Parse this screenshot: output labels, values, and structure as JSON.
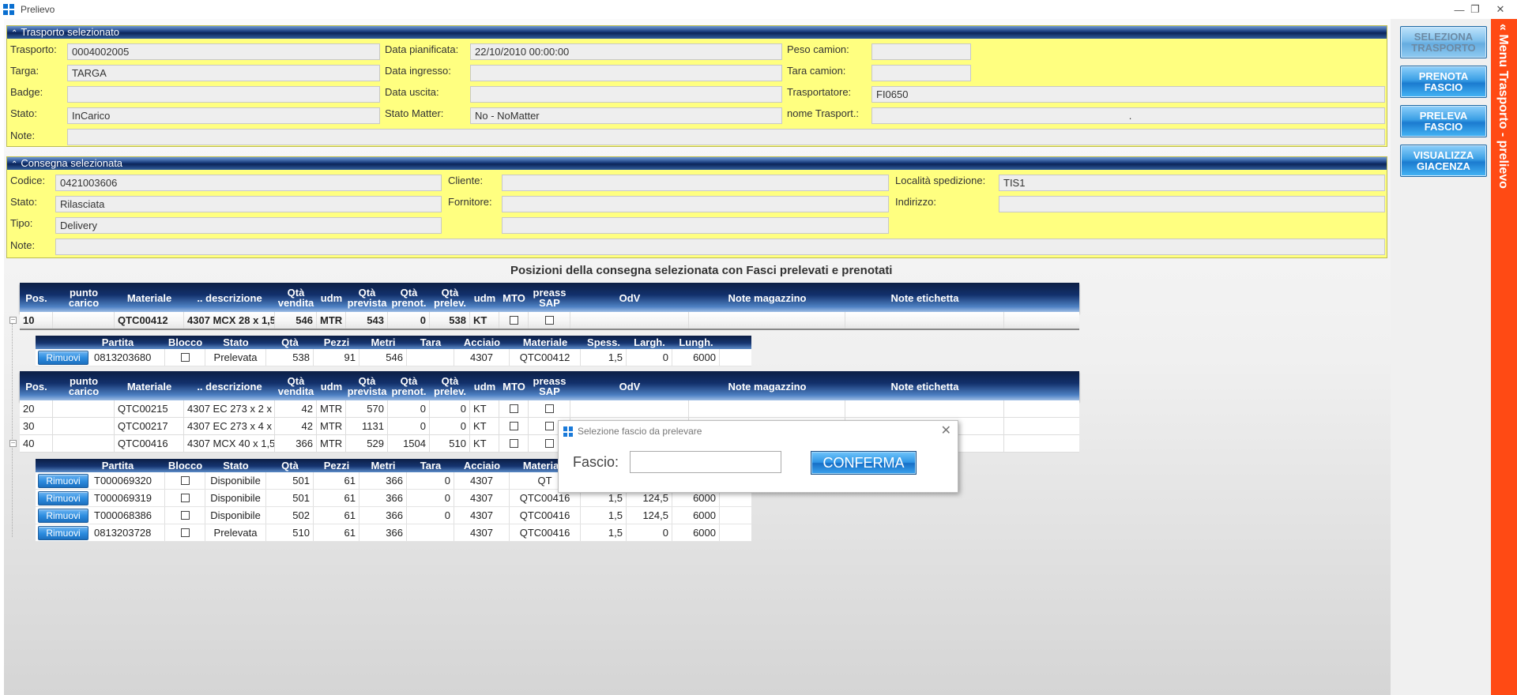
{
  "window": {
    "title": "Prelievo",
    "minimize": "—",
    "restore": "❐",
    "close": "✕"
  },
  "trasporto": {
    "header": "Trasporto selezionato",
    "labels": {
      "trasporto": "Trasporto:",
      "targa": "Targa:",
      "badge": "Badge:",
      "stato": "Stato:",
      "note": "Note:",
      "data_pianificata": "Data pianificata:",
      "data_ingresso": "Data ingresso:",
      "data_uscita": "Data uscita:",
      "stato_matter": "Stato Matter:",
      "peso_camion": "Peso camion:",
      "tara_camion": "Tara camion:",
      "trasportatore": "Trasportatore:",
      "nome_trasport": "nome Trasport.:"
    },
    "values": {
      "trasporto": "0004002005",
      "targa": "TARGA",
      "badge": "",
      "stato": "InCarico",
      "note": "",
      "data_pianificata": "22/10/2010 00:00:00",
      "data_ingresso": "",
      "data_uscita": "",
      "stato_matter": "No - NoMatter",
      "peso_camion": "",
      "tara_camion": "",
      "trasportatore": "FI0650",
      "nome_trasport": "."
    }
  },
  "consegna": {
    "header": "Consegna selezionata",
    "labels": {
      "codice": "Codice:",
      "stato": "Stato:",
      "tipo": "Tipo:",
      "note": "Note:",
      "cliente": "Cliente:",
      "fornitore": "Fornitore:",
      "localita": "Località spedizione:",
      "indirizzo": "Indirizzo:"
    },
    "values": {
      "codice": "0421003606",
      "stato": "Rilasciata",
      "tipo": "Delivery",
      "note": "",
      "cliente": "",
      "fornitore": "",
      "extra": "",
      "localita": "TIS1",
      "indirizzo": ""
    }
  },
  "positions_title": "Posizioni della consegna selezionata con Fasci prelevati e prenotati",
  "grid_headers": [
    "Pos.",
    "punto\ncarico",
    "Materiale",
    ".. descrizione",
    "Qtà\nvendita",
    "udm",
    "Qtà\nprevista",
    "Qtà\nprenot.",
    "Qtà\nprelev.",
    "udm",
    "MTO",
    "preass\nSAP",
    "OdV",
    "Note magazzino",
    "Note etichetta"
  ],
  "sub_headers": [
    "Partita",
    "Blocco",
    "Stato",
    "Qtà",
    "Pezzi",
    "Metri",
    "Tara",
    "Acciaio",
    "Materiale",
    "Spess.",
    "Largh.",
    "Lungh."
  ],
  "remove_label": "Rimuovi",
  "row10": {
    "pos": "10",
    "materiale": "QTC00412",
    "descr": "4307 MCX 28 x 1,5 x",
    "qvend": "546",
    "udm": "MTR",
    "qprev": "543",
    "qpren": "0",
    "qprel": "538",
    "udm2": "KT"
  },
  "sub10": [
    {
      "partita": "0813203680",
      "stato": "Prelevata",
      "qta": "538",
      "pezzi": "91",
      "metri": "546",
      "tara": "",
      "acciaio": "4307",
      "materiale": "QTC00412",
      "spess": "1,5",
      "largh": "0",
      "lungh": "6000"
    }
  ],
  "rows": [
    {
      "pos": "20",
      "materiale": "QTC00215",
      "descr": "4307 EC 273 x 2 x 6",
      "qvend": "42",
      "udm": "MTR",
      "qprev": "570",
      "qpren": "0",
      "qprel": "0",
      "udm2": "KT"
    },
    {
      "pos": "30",
      "materiale": "QTC00217",
      "descr": "4307 EC 273 x 4 x 6",
      "qvend": "42",
      "udm": "MTR",
      "qprev": "1131",
      "qpren": "0",
      "qprel": "0",
      "udm2": "KT"
    },
    {
      "pos": "40",
      "materiale": "QTC00416",
      "descr": "4307 MCX 40 x 1,5 x",
      "qvend": "366",
      "udm": "MTR",
      "qprev": "529",
      "qpren": "1504",
      "qprel": "510",
      "udm2": "KT"
    }
  ],
  "sub40": [
    {
      "partita": "T000069320",
      "stato": "Disponibile",
      "qta": "501",
      "pezzi": "61",
      "metri": "366",
      "tara": "0",
      "acciaio": "4307",
      "materiale": "QT",
      "spess": "",
      "largh": "",
      "lungh": ""
    },
    {
      "partita": "T000069319",
      "stato": "Disponibile",
      "qta": "501",
      "pezzi": "61",
      "metri": "366",
      "tara": "0",
      "acciaio": "4307",
      "materiale": "QTC00416",
      "spess": "1,5",
      "largh": "124,5",
      "lungh": "6000"
    },
    {
      "partita": "T000068386",
      "stato": "Disponibile",
      "qta": "502",
      "pezzi": "61",
      "metri": "366",
      "tara": "0",
      "acciaio": "4307",
      "materiale": "QTC00416",
      "spess": "1,5",
      "largh": "124,5",
      "lungh": "6000"
    },
    {
      "partita": "0813203728",
      "stato": "Prelevata",
      "qta": "510",
      "pezzi": "61",
      "metri": "366",
      "tara": "",
      "acciaio": "4307",
      "materiale": "QTC00416",
      "spess": "1,5",
      "largh": "0",
      "lungh": "6000"
    }
  ],
  "sidebar": {
    "btn1": "SELEZIONA TRASPORTO",
    "btn2": "PRENOTA FASCIO",
    "btn3": "PRELEVA FASCIO",
    "btn4": "VISUALIZZA GIACENZA",
    "menu": "Menu Trasporto - prelievo",
    "menu_chev": "«"
  },
  "dialog": {
    "title": "Selezione fascio da prelevare",
    "label": "Fascio:",
    "value": "",
    "confirm": "CONFERMA",
    "close": "✕"
  },
  "colors": {
    "panel_bg": "#ffff80",
    "accent": "#ff4a14",
    "header_dark": "#12306b",
    "button_blue": "#2e8ee0"
  }
}
